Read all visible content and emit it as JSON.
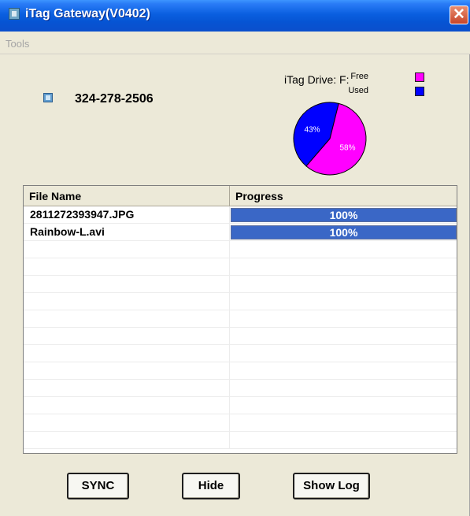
{
  "window": {
    "title": "iTag Gateway(V0402)",
    "close_glyph": "✕",
    "icon": "app-icon"
  },
  "menu": {
    "tools_label": "Tools"
  },
  "device": {
    "icon": "device-icon",
    "id_text": "324-278-2506"
  },
  "drive": {
    "label": "iTag Drive: F:",
    "legend": [
      {
        "label": "Free",
        "color": "#ff00ff"
      },
      {
        "label": "Used",
        "color": "#0000ff"
      }
    ],
    "chart_data": {
      "type": "pie",
      "slices": [
        {
          "label": "58%",
          "value": 58,
          "color": "#ff00ff"
        },
        {
          "label": "43%",
          "value": 43,
          "color": "#0000ff"
        }
      ]
    }
  },
  "table": {
    "columns": [
      "File Name",
      "Progress"
    ],
    "rows": [
      {
        "file": "2811272393947.JPG",
        "progress_value": 1.0,
        "progress_text": "100%"
      },
      {
        "file": "Rainbow-L.avi",
        "progress_value": 1.0,
        "progress_text": "100%"
      }
    ]
  },
  "buttons": {
    "sync": "SYNC",
    "hide": "Hide",
    "show_log": "Show Log"
  },
  "colors": {
    "title_bar": "#0a5fe0",
    "window_bg": "#ece9d8",
    "progress_fill": "#3a67c6"
  }
}
